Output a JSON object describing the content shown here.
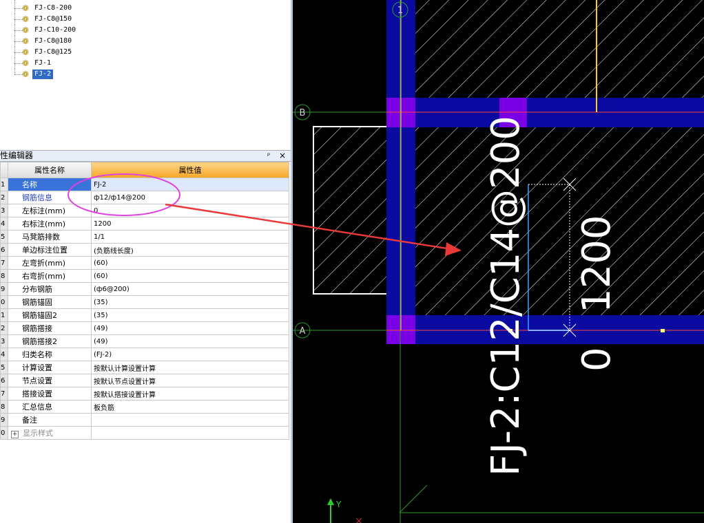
{
  "tree": {
    "items": [
      {
        "label": "FJ-C8-200"
      },
      {
        "label": "FJ-C8@150"
      },
      {
        "label": "FJ-C10-200"
      },
      {
        "label": "FJ-C8@180"
      },
      {
        "label": "FJ-C8@125"
      },
      {
        "label": "FJ-1"
      },
      {
        "label": "FJ-2",
        "selected": true
      }
    ]
  },
  "editor": {
    "title": "性编辑器",
    "pin_glyph": "ᵖ",
    "close_glyph": "×",
    "header_name": "属性名称",
    "header_value": "属性值",
    "rows": [
      {
        "num": "1",
        "name": "名称",
        "value": "FJ-2"
      },
      {
        "num": "2",
        "name": "钢筋信息",
        "value": "ф12/ф14@200"
      },
      {
        "num": "3",
        "name": "左标注(mm)",
        "value": "0"
      },
      {
        "num": "4",
        "name": "右标注(mm)",
        "value": "1200"
      },
      {
        "num": "5",
        "name": "马凳筋排数",
        "value": "1/1"
      },
      {
        "num": "6",
        "name": "单边标注位置",
        "value": "(负筋线长度)"
      },
      {
        "num": "7",
        "name": "左弯折(mm)",
        "value": "(60)"
      },
      {
        "num": "8",
        "name": "右弯折(mm)",
        "value": "(60)"
      },
      {
        "num": "9",
        "name": "分布钢筋",
        "value": "(ф6@200)"
      },
      {
        "num": "0",
        "name": "钢筋锚固",
        "value": "(35)"
      },
      {
        "num": "1",
        "name": "钢筋锚固2",
        "value": "(35)"
      },
      {
        "num": "2",
        "name": "钢筋搭接",
        "value": "(49)"
      },
      {
        "num": "3",
        "name": "钢筋搭接2",
        "value": "(49)"
      },
      {
        "num": "4",
        "name": "归类名称",
        "value": "(FJ-2)"
      },
      {
        "num": "5",
        "name": "计算设置",
        "value": "按默认计算设置计算"
      },
      {
        "num": "6",
        "name": "节点设置",
        "value": "按默认节点设置计算"
      },
      {
        "num": "7",
        "name": "搭接设置",
        "value": "按默认搭接设置计算"
      },
      {
        "num": "8",
        "name": "汇总信息",
        "value": "板负筋"
      },
      {
        "num": "9",
        "name": "备注",
        "value": ""
      },
      {
        "num": "0",
        "name": "显示样式",
        "value": "",
        "expand": "+"
      }
    ]
  },
  "cad": {
    "axis_labels": {
      "col1": "1",
      "rowB": "B",
      "rowA": "A"
    },
    "rebar_label": "FJ-2:C12/C14@200",
    "dim_right": "1200",
    "dim_left": "0",
    "ucs_y": "Y"
  },
  "colors": {
    "beam": "#0a0aa0",
    "column": "#7a00e6",
    "hatch": "#ffffff",
    "annotation_arrow": "#e83a3a",
    "annotation_ellipse": "#e040e0",
    "selection": "#316ac5",
    "header_value": "#f5a623"
  }
}
